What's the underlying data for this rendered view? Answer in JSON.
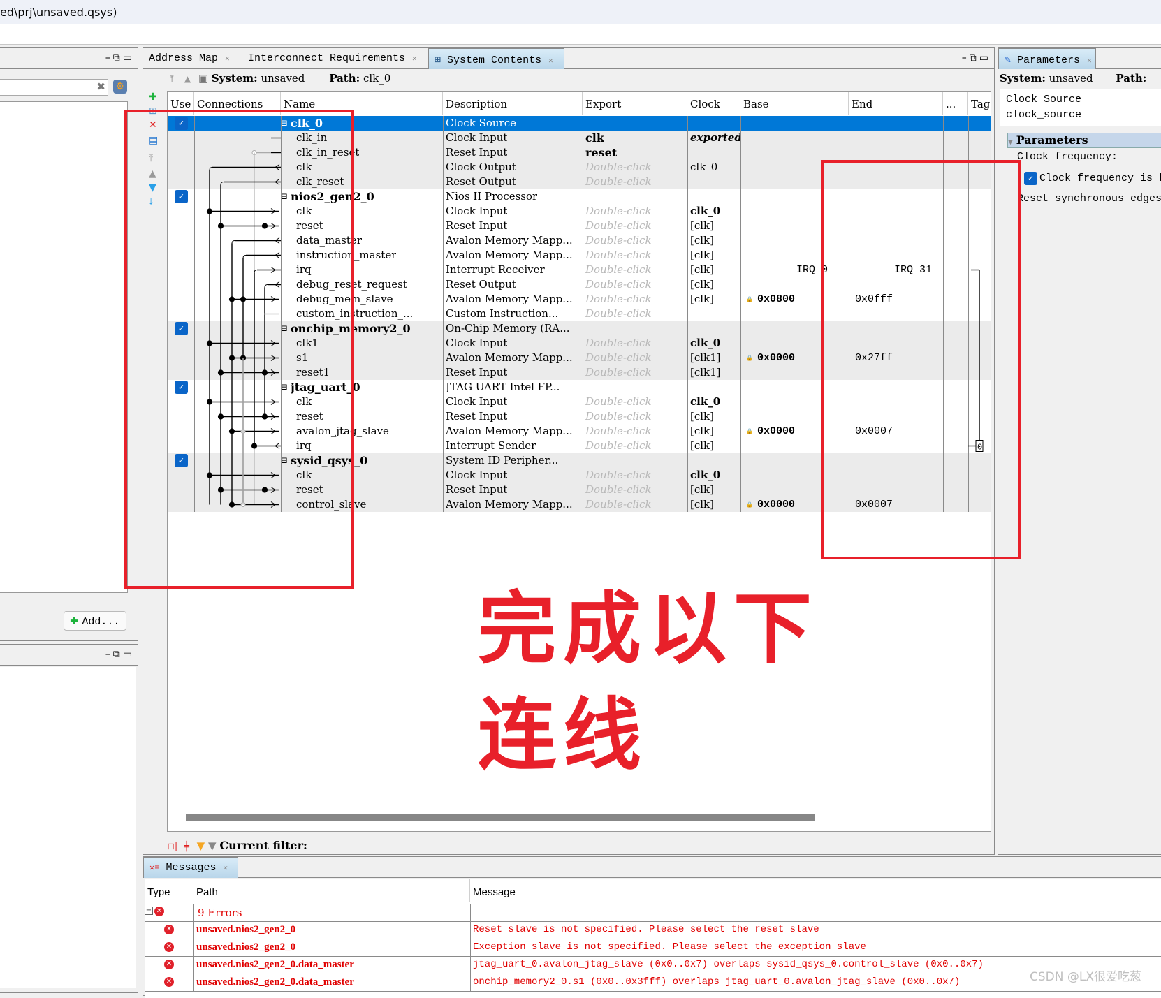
{
  "window": {
    "title": "ed\\prj\\unsaved.qsys)"
  },
  "left_panel": {
    "search_value": "",
    "add_button": "Add...",
    "win_controls": [
      "minimize",
      "restore",
      "maximize"
    ]
  },
  "main": {
    "tabs": [
      {
        "label": "Address Map",
        "active": false
      },
      {
        "label": "Interconnect Requirements",
        "active": false
      },
      {
        "label": "System Contents",
        "active": true
      }
    ],
    "system_label": "System:",
    "system_value": "unsaved",
    "path_label": "Path:",
    "path_value": "clk_0",
    "columns": [
      "Use",
      "Connections",
      "Name",
      "Description",
      "Export",
      "Clock",
      "Base",
      "End",
      "...",
      "Tag"
    ],
    "rows": [
      {
        "name": "clk_0",
        "type": "component",
        "checked": true,
        "selected": true,
        "shade": false,
        "desc": "Clock Source",
        "export": "",
        "export_dc": false,
        "clock": "",
        "clock_bold": false,
        "base": "",
        "end": ""
      },
      {
        "name": "clk_in",
        "type": "port",
        "shade": true,
        "desc": "Clock Input",
        "export": "clk",
        "export_dc": false,
        "export_bold": true,
        "clock": "exported",
        "clock_italic_bold": true,
        "base": "",
        "end": ""
      },
      {
        "name": "clk_in_reset",
        "type": "port",
        "shade": true,
        "desc": "Reset Input",
        "export": "reset",
        "export_dc": false,
        "export_bold": true,
        "clock": "",
        "base": "",
        "end": ""
      },
      {
        "name": "clk",
        "type": "port",
        "shade": true,
        "desc": "Clock Output",
        "export": "Double-click",
        "export_dc": true,
        "clock": "clk_0",
        "base": "",
        "end": ""
      },
      {
        "name": "clk_reset",
        "type": "port",
        "shade": true,
        "desc": "Reset Output",
        "export": "Double-click",
        "export_dc": true,
        "clock": "",
        "base": "",
        "end": ""
      },
      {
        "name": "nios2_gen2_0",
        "type": "component",
        "checked": true,
        "shade": false,
        "desc": "Nios II Processor",
        "export": "",
        "clock": "",
        "base": "",
        "end": ""
      },
      {
        "name": "clk",
        "type": "port",
        "shade": false,
        "desc": "Clock Input",
        "export": "Double-click",
        "export_dc": true,
        "clock": "clk_0",
        "clock_bold": true,
        "base": "",
        "end": ""
      },
      {
        "name": "reset",
        "type": "port",
        "shade": false,
        "desc": "Reset Input",
        "export": "Double-click",
        "export_dc": true,
        "clock": "[clk]",
        "base": "",
        "end": ""
      },
      {
        "name": "data_master",
        "type": "port",
        "shade": false,
        "desc": "Avalon Memory Mapp...",
        "export": "Double-click",
        "export_dc": true,
        "clock": "[clk]",
        "base": "",
        "end": ""
      },
      {
        "name": "instruction_master",
        "type": "port",
        "shade": false,
        "desc": "Avalon Memory Mapp...",
        "export": "Double-click",
        "export_dc": true,
        "clock": "[clk]",
        "base": "",
        "end": ""
      },
      {
        "name": "irq",
        "type": "port",
        "shade": false,
        "desc": "Interrupt Receiver",
        "export": "Double-click",
        "export_dc": true,
        "clock": "[clk]",
        "base": "IRQ 0",
        "end": "IRQ 31"
      },
      {
        "name": "debug_reset_request",
        "type": "port",
        "shade": false,
        "desc": "Reset Output",
        "export": "Double-click",
        "export_dc": true,
        "clock": "[clk]",
        "base": "",
        "end": ""
      },
      {
        "name": "debug_mem_slave",
        "type": "port",
        "shade": false,
        "desc": "Avalon Memory Mapp...",
        "export": "Double-click",
        "export_dc": true,
        "clock": "[clk]",
        "base": "0x0800",
        "end": "0x0fff"
      },
      {
        "name": "custom_instruction_...",
        "type": "port",
        "shade": false,
        "desc": "Custom Instruction...",
        "export": "Double-click",
        "export_dc": true,
        "clock": "",
        "base": "",
        "end": ""
      },
      {
        "name": "onchip_memory2_0",
        "type": "component",
        "checked": true,
        "shade": true,
        "desc": "On-Chip Memory (RA...",
        "export": "",
        "clock": "",
        "base": "",
        "end": ""
      },
      {
        "name": "clk1",
        "type": "port",
        "shade": true,
        "desc": "Clock Input",
        "export": "Double-click",
        "export_dc": true,
        "clock": "clk_0",
        "clock_bold": true,
        "base": "",
        "end": ""
      },
      {
        "name": "s1",
        "type": "port",
        "shade": true,
        "desc": "Avalon Memory Mapp...",
        "export": "Double-click",
        "export_dc": true,
        "clock": "[clk1]",
        "base": "0x0000",
        "end": "0x27ff"
      },
      {
        "name": "reset1",
        "type": "port",
        "shade": true,
        "desc": "Reset Input",
        "export": "Double-click",
        "export_dc": true,
        "clock": "[clk1]",
        "base": "",
        "end": ""
      },
      {
        "name": "jtag_uart_0",
        "type": "component",
        "checked": true,
        "shade": false,
        "desc": "JTAG UART Intel FP...",
        "export": "",
        "clock": "",
        "base": "",
        "end": ""
      },
      {
        "name": "clk",
        "type": "port",
        "shade": false,
        "desc": "Clock Input",
        "export": "Double-click",
        "export_dc": true,
        "clock": "clk_0",
        "clock_bold": true,
        "base": "",
        "end": ""
      },
      {
        "name": "reset",
        "type": "port",
        "shade": false,
        "desc": "Reset Input",
        "export": "Double-click",
        "export_dc": true,
        "clock": "[clk]",
        "base": "",
        "end": ""
      },
      {
        "name": "avalon_jtag_slave",
        "type": "port",
        "shade": false,
        "desc": "Avalon Memory Mapp...",
        "export": "Double-click",
        "export_dc": true,
        "clock": "[clk]",
        "base": "0x0000",
        "end": "0x0007"
      },
      {
        "name": "irq",
        "type": "port",
        "shade": false,
        "desc": "Interrupt Sender",
        "export": "Double-click",
        "export_dc": true,
        "clock": "[clk]",
        "base": "",
        "end": "",
        "irq_value": "0"
      },
      {
        "name": "sysid_qsys_0",
        "type": "component",
        "checked": true,
        "shade": true,
        "desc": "System ID Peripher...",
        "export": "",
        "clock": "",
        "base": "",
        "end": ""
      },
      {
        "name": "clk",
        "type": "port",
        "shade": true,
        "desc": "Clock Input",
        "export": "Double-click",
        "export_dc": true,
        "clock": "clk_0",
        "clock_bold": true,
        "base": "",
        "end": ""
      },
      {
        "name": "reset",
        "type": "port",
        "shade": true,
        "desc": "Reset Input",
        "export": "Double-click",
        "export_dc": true,
        "clock": "[clk]",
        "base": "",
        "end": ""
      },
      {
        "name": "control_slave",
        "type": "port",
        "shade": true,
        "desc": "Avalon Memory Mapp...",
        "export": "Double-click",
        "export_dc": true,
        "clock": "[clk]",
        "base": "0x0000",
        "end": "0x0007"
      }
    ],
    "filter_label": "Current filter:"
  },
  "annotation": {
    "line1": "完成以下",
    "line2": "连线",
    "color": "#e8202a"
  },
  "parameters": {
    "tab_label": "Parameters",
    "system_label": "System:",
    "system_value": "unsaved",
    "path_label": "Path:",
    "component_title": "Clock Source",
    "component_type": "clock_source",
    "section_title": "Parameters",
    "clock_frequency_label": "Clock frequency:",
    "clock_known_label": "Clock frequency is k",
    "clock_known_checked": true,
    "reset_sync_label": "Reset synchronous edges"
  },
  "messages": {
    "tab_label": "Messages",
    "columns": [
      "Type",
      "Path",
      "Message"
    ],
    "summary": "9 Errors",
    "items": [
      {
        "path": "unsaved.nios2_gen2_0",
        "message": "Reset slave is not specified. Please select the reset slave"
      },
      {
        "path": "unsaved.nios2_gen2_0",
        "message": "Exception slave is not specified. Please select the exception slave"
      },
      {
        "path": "unsaved.nios2_gen2_0.data_master",
        "message": "jtag_uart_0.avalon_jtag_slave (0x0..0x7) overlaps sysid_qsys_0.control_slave (0x0..0x7)"
      },
      {
        "path": "unsaved.nios2_gen2_0.data_master",
        "message": "onchip_memory2_0.s1 (0x0..0x3fff) overlaps jtag_uart_0.avalon_jtag_slave (0x0..0x7)"
      }
    ]
  },
  "watermark": "CSDN @LX很爱吃葱",
  "colors": {
    "selection": "#0078d7",
    "error": "#e00000",
    "accent_red": "#e8202a",
    "checkbox": "#0a65c8"
  }
}
